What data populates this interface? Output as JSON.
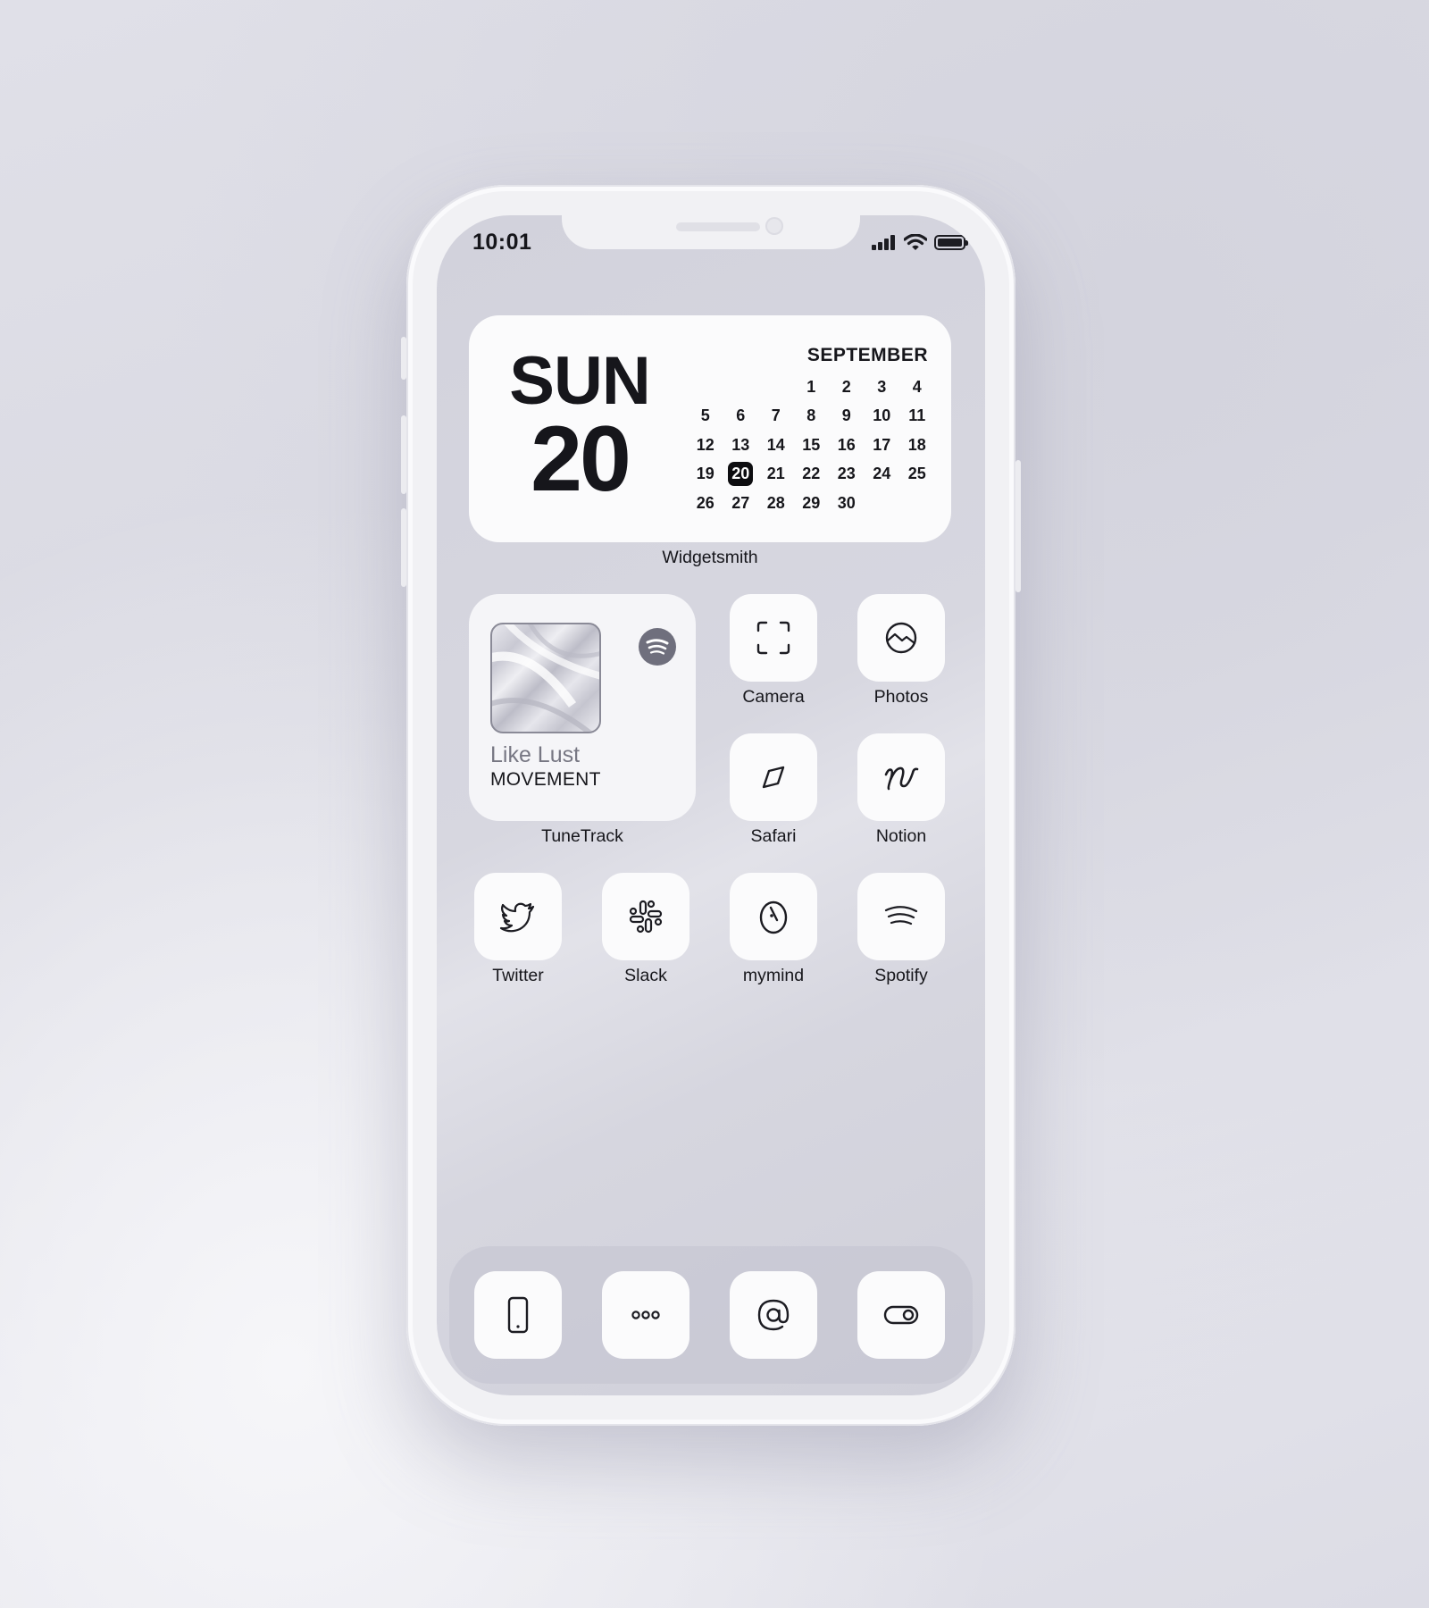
{
  "status_bar": {
    "time": "10:01"
  },
  "calendar_widget": {
    "day_name": "SUN",
    "day_number": "20",
    "month": "SEPTEMBER",
    "days": [
      "",
      "",
      "",
      "1",
      "2",
      "3",
      "4",
      "5",
      "6",
      "7",
      "8",
      "9",
      "10",
      "11",
      "12",
      "13",
      "14",
      "15",
      "16",
      "17",
      "18",
      "19",
      "20",
      "21",
      "22",
      "23",
      "24",
      "25",
      "26",
      "27",
      "28",
      "29",
      "30"
    ],
    "today": "20",
    "label": "Widgetsmith"
  },
  "music_widget": {
    "song": "Like Lust",
    "artist": "MOVEMENT",
    "label": "TuneTrack",
    "source_icon": "spotify-icon"
  },
  "apps": [
    {
      "label": "Camera",
      "icon": "camera-viewfinder-icon"
    },
    {
      "label": "Photos",
      "icon": "photos-landscape-icon"
    },
    {
      "label": "Safari",
      "icon": "compass-icon"
    },
    {
      "label": "Notion",
      "icon": "notion-n-icon"
    },
    {
      "label": "Twitter",
      "icon": "twitter-bird-icon"
    },
    {
      "label": "Slack",
      "icon": "slack-icon"
    },
    {
      "label": "mymind",
      "icon": "mymind-icon"
    },
    {
      "label": "Spotify",
      "icon": "spotify-icon"
    }
  ],
  "dock": [
    {
      "icon": "phone-icon"
    },
    {
      "icon": "messages-dots-icon"
    },
    {
      "icon": "mail-at-icon"
    },
    {
      "icon": "settings-toggle-icon"
    }
  ],
  "colors": {
    "widget_bg": "#fbfbfc",
    "text": "#16161b",
    "muted": "#777783",
    "badge": "#6f6f7d"
  }
}
